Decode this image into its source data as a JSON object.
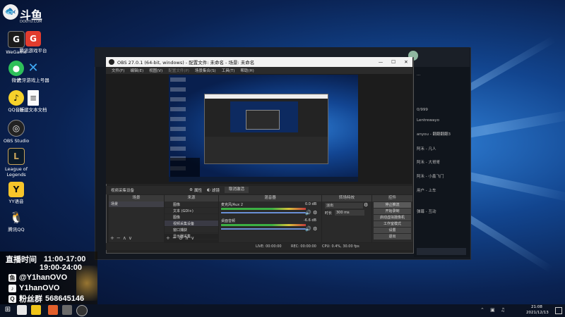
{
  "desktop": {
    "logo_text": "斗鱼",
    "logo_sub": "DOUYU.COM",
    "icons": [
      {
        "label": "WeGame"
      },
      {
        "label": "腾讯游戏平台"
      },
      {
        "label": "微信"
      },
      {
        "label": "虎牙游戏上号器"
      },
      {
        "label": "QQ音乐"
      },
      {
        "label": "新建文本文档"
      },
      {
        "label": "OBS Studio"
      },
      {
        "label": "League of Legends"
      },
      {
        "label": "YY语音"
      },
      {
        "label": "腾讯QQ"
      }
    ]
  },
  "overlay": {
    "schedule_label": "直播时间",
    "time1": "11:00-17:00",
    "time2": "19:00-24:00",
    "handle1": "@Y1hanOVO",
    "handle2": "Y1hanOVO",
    "fan_label": "粉丝群",
    "fan_group": "568645146"
  },
  "obs": {
    "title": "OBS 27.0.1 (64-bit, windows) - 配置文件: 未命名 - 场景: 未命名",
    "menu": [
      "文件(F)",
      "编辑(E)",
      "视图(V)",
      "配置文件(P)",
      "场景集合(S)",
      "工具(T)",
      "帮助(H)"
    ],
    "source_name": "视频采集设备",
    "props_label": "属性",
    "filters_label": "滤镜",
    "deactivate_label": "取消激活",
    "docks": {
      "scenes": "场景",
      "sources": "来源",
      "mixer": "混音器",
      "transitions": "转场特效",
      "controls": "控件"
    },
    "scene_item": "场景",
    "sources": [
      "图像",
      "文本 (GDI+)",
      "图像",
      "视频采集设备",
      "窗口捕获",
      "显示器采集"
    ],
    "mixer": [
      {
        "name": "麦克风/Aux 2",
        "level": "0.0 dB"
      },
      {
        "name": "桌面音频",
        "level": "-6.6 dB"
      }
    ],
    "transition": "淡出",
    "duration_label": "时长",
    "duration_value": "300 ms",
    "controls": [
      "停止推流",
      "开始录制",
      "启动虚拟摄像机",
      "工作室模式",
      "设置",
      "退出"
    ],
    "status": {
      "live": "LIVE: 00:00:00",
      "rec": "REC: 00:00:00",
      "cpu": "CPU: 0.4%, 30.00 fps"
    },
    "pip_window": "Y1han"
  },
  "stream_app": {
    "chat_lines": [
      "...",
      "0/999",
      "Lentrewayo",
      "anyou - 翻翻翻翻3",
      "阿禾 - 凡人",
      "阿禾 - 大哥哥",
      "阿禾 - 小鑫飞门",
      "用户 - 上车",
      "弹幕 - 互动"
    ]
  },
  "taskbar": {
    "time": "21:08",
    "date": "2021/12/13"
  }
}
